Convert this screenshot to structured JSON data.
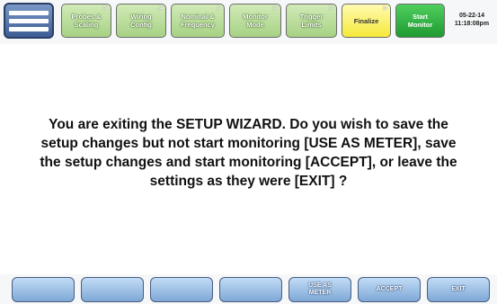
{
  "header": {
    "menu_icon": "hamburger-menu-icon",
    "steps": [
      {
        "label": "Probes &\nScaling"
      },
      {
        "label": "Wiring\nConfig"
      },
      {
        "label": "Nominal &\nFrequency"
      },
      {
        "label": "Monitor\nMode"
      },
      {
        "label": "Trigger\nLimits"
      },
      {
        "label": "Finalize"
      },
      {
        "label": "Start\nMonitor"
      }
    ],
    "chevron": ">",
    "date": "05-22-14",
    "time": "11:18:08pm"
  },
  "dialog": {
    "message": "You are exiting the SETUP WIZARD.  Do you wish to save the setup changes but not start monitoring [USE AS METER], save the setup changes and start monitoring [ACCEPT], or leave the settings as they were [EXIT] ?"
  },
  "footer": {
    "keys": [
      {
        "label": ""
      },
      {
        "label": ""
      },
      {
        "label": ""
      },
      {
        "label": ""
      },
      {
        "label": "USE AS\nMETER"
      },
      {
        "label": "ACCEPT"
      },
      {
        "label": "EXIT"
      }
    ]
  },
  "colors": {
    "step_green": "#a6d184",
    "step_current_yellow": "#f5e93a",
    "start_green": "#1f9a31",
    "key_blue": "#7ea8d6"
  }
}
